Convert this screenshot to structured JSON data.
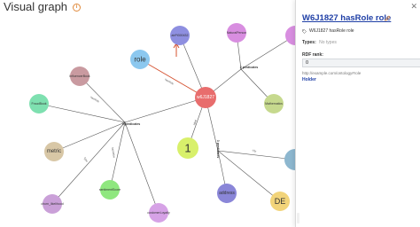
{
  "header": {
    "title": "Visual graph",
    "info_icon": "info-icon"
  },
  "graph": {
    "colors": {
      "edge": "#555555",
      "edge_highlight": "#d4502e",
      "arrow_annotation": "#d4502e"
    },
    "nodes": [
      {
        "id": "n_w6j",
        "label": "w6J1827",
        "color": "#e86d6d",
        "text_color": "#ffffff"
      },
      {
        "id": "n_role",
        "label": "role",
        "color": "#8cc8ef",
        "text_color": "#333333"
      },
      {
        "id": "n_top",
        "label": "abPt300432",
        "color": "#8e8fe0",
        "text_color": "#333333"
      },
      {
        "id": "n_natural",
        "label": "NaturalPerson",
        "color": "#d88ee0",
        "text_color": "#333333"
      },
      {
        "id": "n_influence",
        "label": "InfluencerBook",
        "color": "#c99aa0",
        "text_color": "#333333"
      },
      {
        "id": "n_fraudbook",
        "label": "FraudBook",
        "color": "#7ee0b0",
        "text_color": "#333333"
      },
      {
        "id": "n_metric",
        "label": "metric",
        "color": "#d8c7a6",
        "text_color": "#333333"
      },
      {
        "id": "n_mathematics",
        "label": "Mathematics",
        "color": "#c6d98e",
        "text_color": "#333333"
      },
      {
        "id": "n_one",
        "label": "1",
        "color": "#d8f06b",
        "text_color": "#333333"
      },
      {
        "id": "n_sentiment",
        "label": "sentimentScore",
        "color": "#8fe77f",
        "text_color": "#333333"
      },
      {
        "id": "n_customer",
        "label": "customerLoyalty",
        "color": "#d6a2e6",
        "text_color": "#333333"
      },
      {
        "id": "n_churn",
        "label": "churn_likelihood",
        "color": "#caa0d8",
        "text_color": "#333333"
      },
      {
        "id": "n_address",
        "label": "address",
        "color": "#8a86d8",
        "text_color": "#333333"
      },
      {
        "id": "n_de",
        "label": "DE",
        "color": "#f2d47a",
        "text_color": "#333333"
      },
      {
        "id": "n_edge_right",
        "label": "",
        "color": "#8db7cf",
        "text_color": "#333333"
      },
      {
        "id": "n_edge_topright",
        "label": "",
        "color": "#d88ee0",
        "text_color": "#333333"
      }
    ],
    "edge_labels": [
      {
        "id": "el_5pred_left",
        "text": "5 predicates",
        "bold": true
      },
      {
        "id": "el_2pred_top",
        "text": "2 predicates",
        "bold": true
      },
      {
        "id": "el_3pred_bottom",
        "text": "3 predicates",
        "bold": true
      },
      {
        "id": "el_hasrole",
        "text": "hasRole",
        "bold": false
      },
      {
        "id": "el_label",
        "text": "label",
        "bold": false
      },
      {
        "id": "el_hasvalue",
        "text": "hasValue",
        "bold": false
      },
      {
        "id": "el_type",
        "text": "type",
        "bold": false
      },
      {
        "id": "el_hasrole2",
        "text": "hasRole",
        "bold": false
      },
      {
        "id": "el_city",
        "text": "city",
        "bold": false
      }
    ]
  },
  "panel": {
    "close_icon": "close-icon",
    "title": "W6J1827 hasRole role",
    "edit_icon": "pencil-icon",
    "tag_icon": "tag-icon",
    "tag_text": "W6J1827 hasRole role",
    "types_label": "Types:",
    "types_value": "No types",
    "rdf_rank_label": "RDF rank:",
    "rdf_rank_value": "0",
    "url": "http://example.com/ontology#role",
    "holder": "Holder"
  }
}
